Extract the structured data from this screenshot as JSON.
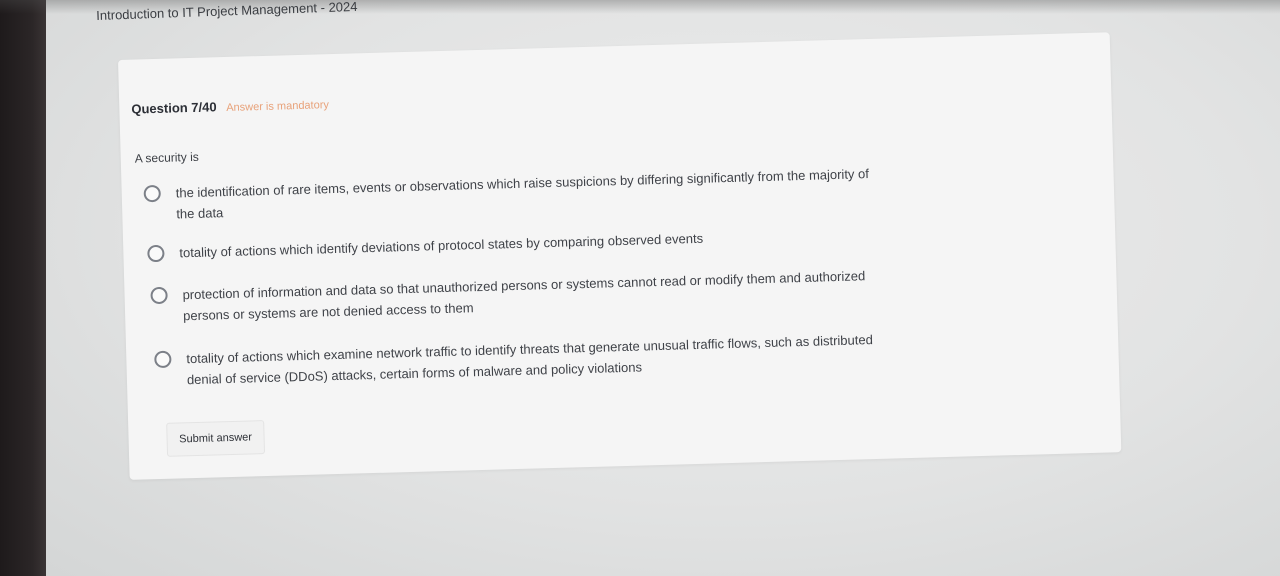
{
  "app": {
    "title": "Introduction to IT Project Management - 2024"
  },
  "question": {
    "number_label": "Question 7/40",
    "mandatory_label": "Answer is mandatory",
    "text": "A security is",
    "options": [
      {
        "label": "the identification of rare items, events or observations which raise suspicions by differing significantly from the majority of the data",
        "selected": false
      },
      {
        "label": "totality of actions which identify deviations of protocol states by comparing observed events",
        "selected": false
      },
      {
        "label": "protection of information and data so that unauthorized persons or systems cannot read or modify them and authorized persons or systems are not denied access to them",
        "selected": false
      },
      {
        "label": "totality of actions which examine network traffic to identify threats that generate unusual traffic flows, such as distributed denial of service (DDoS) attacks, certain forms of malware and policy violations",
        "selected": false
      }
    ]
  },
  "submit": {
    "label": "Submit answer"
  },
  "colors": {
    "mandatory": "#e8a27a",
    "text": "#3f4248",
    "card": "#f5f5f5"
  }
}
